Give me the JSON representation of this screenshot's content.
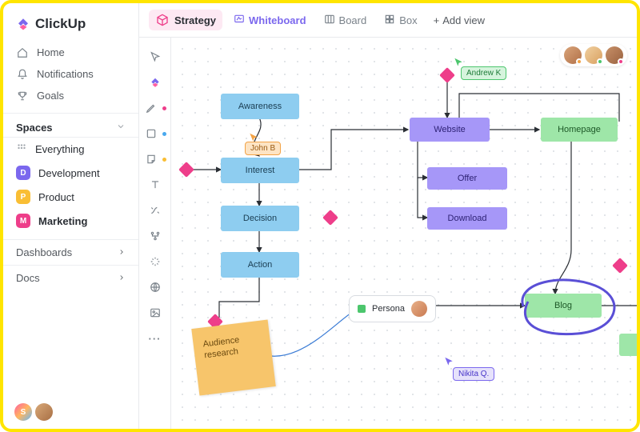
{
  "brand": {
    "name": "ClickUp"
  },
  "sidebar": {
    "nav": [
      {
        "label": "Home",
        "icon": "home-icon"
      },
      {
        "label": "Notifications",
        "icon": "bell-icon"
      },
      {
        "label": "Goals",
        "icon": "trophy-icon"
      }
    ],
    "spaces_label": "Spaces",
    "everything_label": "Everything",
    "spaces": [
      {
        "label": "Development",
        "badge": "D",
        "color": "#7b68ee"
      },
      {
        "label": "Product",
        "badge": "P",
        "color": "#f9be34"
      },
      {
        "label": "Marketing",
        "badge": "M",
        "color": "#ee3e8a",
        "active": true
      }
    ],
    "dashboards_label": "Dashboards",
    "docs_label": "Docs",
    "footer_avatars": [
      {
        "initial": "S",
        "bg": "linear-gradient(135deg,#ff5fa2,#ffb65f,#5fb7ff)"
      },
      {
        "initial": "",
        "bg": "linear-gradient(135deg,#d8a878,#a86f44)"
      }
    ]
  },
  "topbar": {
    "breadcrumb": "Strategy",
    "views": [
      {
        "label": "Whiteboard",
        "icon": "whiteboard-icon",
        "active": true
      },
      {
        "label": "Board",
        "icon": "board-icon"
      },
      {
        "label": "Box",
        "icon": "box-icon"
      }
    ],
    "add_view": "Add view"
  },
  "whiteboard": {
    "nodes": {
      "awareness": "Awareness",
      "interest": "Interest",
      "decision": "Decision",
      "action": "Action",
      "website": "Website",
      "offer": "Offer",
      "download": "Download",
      "homepage": "Homepage",
      "blog": "Blog",
      "persona": "Persona"
    },
    "sticky": {
      "line1": "Audience",
      "line2": "research"
    },
    "cursors": {
      "john": {
        "label": "John B",
        "color": "#f3a346"
      },
      "andrew": {
        "label": "Andrew K",
        "color": "#4cc66d"
      },
      "nikita": {
        "label": "Nikita Q.",
        "color": "#7b68ee"
      }
    },
    "top_avatars": [
      {
        "bg": "linear-gradient(135deg,#d9a47a,#b17047)",
        "dot": "#f3a346"
      },
      {
        "bg": "linear-gradient(135deg,#f0d0a0,#d9a060)",
        "dot": "#4cc66d"
      },
      {
        "bg": "linear-gradient(135deg,#c79068,#9a6240)",
        "dot": "#ee3e8a"
      }
    ]
  }
}
